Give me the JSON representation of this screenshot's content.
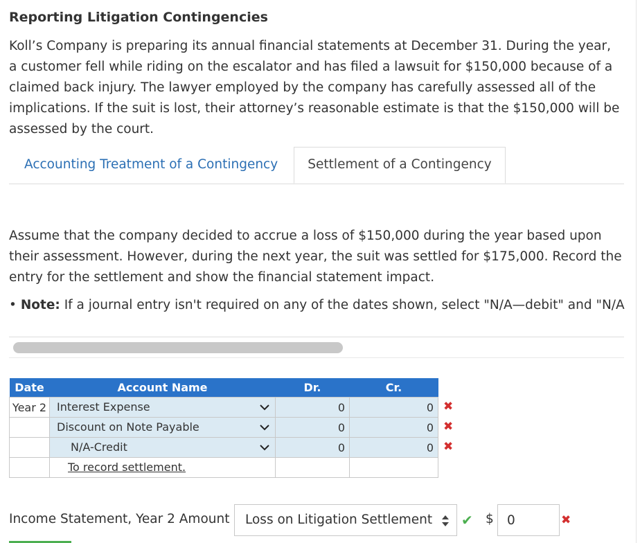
{
  "title": "Reporting Litigation Contingencies",
  "intro": "Koll’s Company is preparing its annual financial statements at December 31. During the year, a customer fell while riding on the escalator and has filed a lawsuit for $150,000 because of a claimed back injury. The lawyer employed by the company has carefully assessed all of the implications. If the suit is lost, their attorney’s reasonable estimate is that the $150,000 will be assessed by the court.",
  "tabs": [
    {
      "label": "Accounting Treatment of a Contingency",
      "active": false
    },
    {
      "label": "Settlement of a Contingency",
      "active": true
    }
  ],
  "instructions": "Assume that the company decided to accrue a loss of $150,000 during the year based upon their assessment. However, during the next year, the suit was settled for $175,000. Record the entry for the settlement and show the financial statement impact.",
  "note": {
    "bullet": "•",
    "label": "Note:",
    "text": "If a journal entry isn't required on any of the dates shown, select \"N/A—debit\" and \"N/A"
  },
  "journal": {
    "headers": {
      "date": "Date",
      "account": "Account Name",
      "dr": "Dr.",
      "cr": "Cr."
    },
    "rows": [
      {
        "date": "Year 2",
        "account": "Interest Expense",
        "dr": "0",
        "cr": "0",
        "mark": "✖"
      },
      {
        "date": "",
        "account": "Discount on Note Payable",
        "dr": "0",
        "cr": "0",
        "mark": "✖"
      },
      {
        "date": "",
        "account": "N/A-Credit",
        "dr": "0",
        "cr": "0",
        "mark": "✖"
      }
    ],
    "memo": "To record settlement."
  },
  "income_statement": {
    "label": "Income Statement, Year 2 Amount",
    "selected": "Loss on Litigation Settlement",
    "check": "✔",
    "currency": "$",
    "amount": "0",
    "mark": "✖"
  },
  "colors": {
    "accent": "#2a73c9",
    "link": "#2b6fb4",
    "error": "#d32f2f",
    "success": "#4caf50",
    "row_shade": "#dbeaf3"
  }
}
